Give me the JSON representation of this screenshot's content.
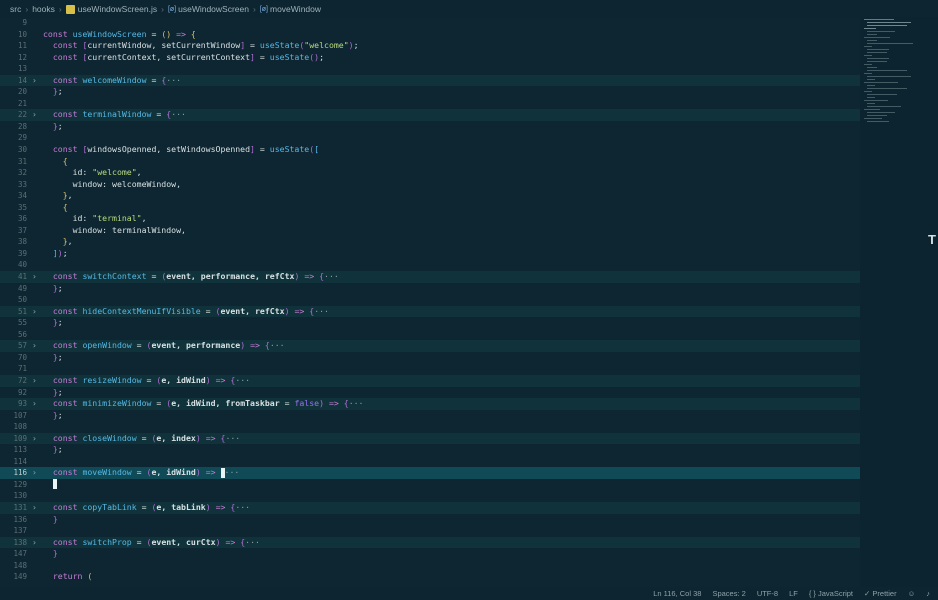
{
  "breadcrumb": {
    "items": [
      "src",
      "hooks",
      "useWindowScreen.js",
      "useWindowScreen",
      "moveWindow"
    ],
    "symbol_prefix": "[ø]"
  },
  "status": {
    "position": "Ln 116, Col 38",
    "spaces": "Spaces: 2",
    "encoding": "UTF-8",
    "eol": "LF",
    "language": "{ } JavaScript",
    "formatter": "✓ Prettier",
    "feedback_icon": "person-icon",
    "bell_icon": "bell-icon"
  },
  "colors": {
    "background": "#0d2631",
    "keyword": "#c77dd6",
    "variable": "#e7a35b",
    "function": "#56b8e6",
    "string": "#b9d981",
    "current_line": "#0f4a56"
  },
  "lines": [
    {
      "n": "9",
      "fold": false,
      "segs": []
    },
    {
      "n": "10",
      "fold": false,
      "segs": [
        [
          "k",
          "const "
        ],
        [
          "f",
          "useWindowScreen"
        ],
        [
          "w",
          " = "
        ],
        [
          "p",
          "()"
        ],
        [
          "w",
          " "
        ],
        [
          "k",
          "=>"
        ],
        [
          "w",
          " "
        ],
        [
          "p",
          "{"
        ]
      ]
    },
    {
      "n": "11",
      "fold": false,
      "segs": [
        [
          "w",
          "  "
        ],
        [
          "k",
          "const "
        ],
        [
          "pp",
          "["
        ],
        [
          "w",
          "currentWindow, setCurrentWindow"
        ],
        [
          "pp",
          "]"
        ],
        [
          "w",
          " = "
        ],
        [
          "f",
          "useState"
        ],
        [
          "pp",
          "("
        ],
        [
          "s",
          "\"welcome\""
        ],
        [
          "pp",
          ")"
        ],
        [
          "w",
          ";"
        ]
      ]
    },
    {
      "n": "12",
      "fold": false,
      "segs": [
        [
          "w",
          "  "
        ],
        [
          "k",
          "const "
        ],
        [
          "pp",
          "["
        ],
        [
          "w",
          "currentContext, setCurrentContext"
        ],
        [
          "pp",
          "]"
        ],
        [
          "w",
          " = "
        ],
        [
          "f",
          "useState"
        ],
        [
          "pp",
          "()"
        ],
        [
          "w",
          ";"
        ]
      ]
    },
    {
      "n": "13",
      "fold": false,
      "segs": []
    },
    {
      "n": "14",
      "fold": true,
      "segs": [
        [
          "w",
          "  "
        ],
        [
          "k",
          "const "
        ],
        [
          "f",
          "welcomeWindow"
        ],
        [
          "w",
          " = "
        ],
        [
          "pp",
          "{"
        ],
        [
          "fold-ell",
          "···"
        ]
      ]
    },
    {
      "n": "20",
      "fold": false,
      "segs": [
        [
          "w",
          "  "
        ],
        [
          "pp",
          "}"
        ],
        [
          "w",
          ";"
        ]
      ]
    },
    {
      "n": "21",
      "fold": false,
      "segs": []
    },
    {
      "n": "22",
      "fold": true,
      "segs": [
        [
          "w",
          "  "
        ],
        [
          "k",
          "const "
        ],
        [
          "f",
          "terminalWindow"
        ],
        [
          "w",
          " = "
        ],
        [
          "pp",
          "{"
        ],
        [
          "fold-ell",
          "···"
        ]
      ]
    },
    {
      "n": "28",
      "fold": false,
      "segs": [
        [
          "w",
          "  "
        ],
        [
          "pp",
          "}"
        ],
        [
          "w",
          ";"
        ]
      ]
    },
    {
      "n": "29",
      "fold": false,
      "segs": []
    },
    {
      "n": "30",
      "fold": false,
      "segs": [
        [
          "w",
          "  "
        ],
        [
          "k",
          "const "
        ],
        [
          "pp",
          "["
        ],
        [
          "w",
          "windowsOpenned, setWindowsOpenned"
        ],
        [
          "pp",
          "]"
        ],
        [
          "w",
          " = "
        ],
        [
          "f",
          "useState"
        ],
        [
          "pp",
          "("
        ],
        [
          "f",
          "["
        ]
      ]
    },
    {
      "n": "31",
      "fold": false,
      "segs": [
        [
          "w",
          "    "
        ],
        [
          "p",
          "{"
        ]
      ]
    },
    {
      "n": "32",
      "fold": false,
      "segs": [
        [
          "w",
          "      id: "
        ],
        [
          "s",
          "\"welcome\""
        ],
        [
          "w",
          ","
        ]
      ]
    },
    {
      "n": "33",
      "fold": false,
      "segs": [
        [
          "w",
          "      window: welcomeWindow,"
        ]
      ]
    },
    {
      "n": "34",
      "fold": false,
      "segs": [
        [
          "w",
          "    "
        ],
        [
          "p",
          "}"
        ],
        [
          "w",
          ","
        ]
      ]
    },
    {
      "n": "35",
      "fold": false,
      "segs": [
        [
          "w",
          "    "
        ],
        [
          "p",
          "{"
        ]
      ]
    },
    {
      "n": "36",
      "fold": false,
      "segs": [
        [
          "w",
          "      id: "
        ],
        [
          "s",
          "\"terminal\""
        ],
        [
          "w",
          ","
        ]
      ]
    },
    {
      "n": "37",
      "fold": false,
      "segs": [
        [
          "w",
          "      window: terminalWindow,"
        ]
      ]
    },
    {
      "n": "38",
      "fold": false,
      "segs": [
        [
          "w",
          "    "
        ],
        [
          "p",
          "}"
        ],
        [
          "w",
          ","
        ]
      ]
    },
    {
      "n": "39",
      "fold": false,
      "segs": [
        [
          "w",
          "  "
        ],
        [
          "f",
          "]"
        ],
        [
          "pp",
          ")"
        ],
        [
          "w",
          ";"
        ]
      ]
    },
    {
      "n": "40",
      "fold": false,
      "segs": []
    },
    {
      "n": "41",
      "fold": true,
      "segs": [
        [
          "w",
          "  "
        ],
        [
          "k",
          "const "
        ],
        [
          "f",
          "switchContext"
        ],
        [
          "w",
          " = "
        ],
        [
          "pp",
          "("
        ],
        [
          "b",
          "event, performance, refCtx"
        ],
        [
          "pp",
          ")"
        ],
        [
          "w",
          " "
        ],
        [
          "k",
          "=>"
        ],
        [
          "w",
          " "
        ],
        [
          "pp",
          "{"
        ],
        [
          "fold-ell",
          "···"
        ]
      ]
    },
    {
      "n": "49",
      "fold": false,
      "segs": [
        [
          "w",
          "  "
        ],
        [
          "pp",
          "}"
        ],
        [
          "w",
          ";"
        ]
      ]
    },
    {
      "n": "50",
      "fold": false,
      "segs": []
    },
    {
      "n": "51",
      "fold": true,
      "segs": [
        [
          "w",
          "  "
        ],
        [
          "k",
          "const "
        ],
        [
          "f",
          "hideContextMenuIfVisible"
        ],
        [
          "w",
          " = "
        ],
        [
          "pp",
          "("
        ],
        [
          "b",
          "event, refCtx"
        ],
        [
          "pp",
          ")"
        ],
        [
          "w",
          " "
        ],
        [
          "k",
          "=>"
        ],
        [
          "w",
          " "
        ],
        [
          "pp",
          "{"
        ],
        [
          "fold-ell",
          "···"
        ]
      ]
    },
    {
      "n": "55",
      "fold": false,
      "segs": [
        [
          "w",
          "  "
        ],
        [
          "pp",
          "}"
        ],
        [
          "w",
          ";"
        ]
      ]
    },
    {
      "n": "56",
      "fold": false,
      "segs": []
    },
    {
      "n": "57",
      "fold": true,
      "segs": [
        [
          "w",
          "  "
        ],
        [
          "k",
          "const "
        ],
        [
          "f",
          "openWindow"
        ],
        [
          "w",
          " = "
        ],
        [
          "pp",
          "("
        ],
        [
          "b",
          "event, performance"
        ],
        [
          "pp",
          ")"
        ],
        [
          "w",
          " "
        ],
        [
          "k",
          "=>"
        ],
        [
          "w",
          " "
        ],
        [
          "pp",
          "{"
        ],
        [
          "fold-ell",
          "···"
        ]
      ]
    },
    {
      "n": "70",
      "fold": false,
      "segs": [
        [
          "w",
          "  "
        ],
        [
          "pp",
          "}"
        ],
        [
          "w",
          ";"
        ]
      ]
    },
    {
      "n": "71",
      "fold": false,
      "segs": []
    },
    {
      "n": "72",
      "fold": true,
      "segs": [
        [
          "w",
          "  "
        ],
        [
          "k",
          "const "
        ],
        [
          "f",
          "resizeWindow"
        ],
        [
          "w",
          " = "
        ],
        [
          "pp",
          "("
        ],
        [
          "b",
          "e, idWind"
        ],
        [
          "pp",
          ")"
        ],
        [
          "w",
          " "
        ],
        [
          "k",
          "=>"
        ],
        [
          "w",
          " "
        ],
        [
          "pp",
          "{"
        ],
        [
          "fold-ell",
          "···"
        ]
      ]
    },
    {
      "n": "92",
      "fold": false,
      "segs": [
        [
          "w",
          "  "
        ],
        [
          "pp",
          "}"
        ],
        [
          "w",
          ";"
        ]
      ]
    },
    {
      "n": "93",
      "fold": true,
      "segs": [
        [
          "w",
          "  "
        ],
        [
          "k",
          "const "
        ],
        [
          "f",
          "minimizeWindow"
        ],
        [
          "w",
          " = "
        ],
        [
          "pp",
          "("
        ],
        [
          "b",
          "e, idWind, fromTaskbar"
        ],
        [
          "w",
          " = "
        ],
        [
          "bool",
          "false"
        ],
        [
          "pp",
          ")"
        ],
        [
          "w",
          " "
        ],
        [
          "k",
          "=>"
        ],
        [
          "w",
          " "
        ],
        [
          "pp",
          "{"
        ],
        [
          "fold-ell",
          "···"
        ]
      ]
    },
    {
      "n": "107",
      "fold": false,
      "segs": [
        [
          "w",
          "  "
        ],
        [
          "pp",
          "}"
        ],
        [
          "w",
          ";"
        ]
      ]
    },
    {
      "n": "108",
      "fold": false,
      "segs": []
    },
    {
      "n": "109",
      "fold": true,
      "segs": [
        [
          "w",
          "  "
        ],
        [
          "k",
          "const "
        ],
        [
          "f",
          "closeWindow"
        ],
        [
          "w",
          " = "
        ],
        [
          "pp",
          "("
        ],
        [
          "b",
          "e, index"
        ],
        [
          "pp",
          ")"
        ],
        [
          "w",
          " "
        ],
        [
          "k",
          "=>"
        ],
        [
          "w",
          " "
        ],
        [
          "pp",
          "{"
        ],
        [
          "fold-ell",
          "···"
        ]
      ]
    },
    {
      "n": "113",
      "fold": false,
      "segs": [
        [
          "w",
          "  "
        ],
        [
          "pp",
          "}"
        ],
        [
          "w",
          ";"
        ]
      ]
    },
    {
      "n": "114",
      "fold": false,
      "segs": []
    },
    {
      "n": "116",
      "fold": true,
      "current": true,
      "segs": [
        [
          "w",
          "  "
        ],
        [
          "k",
          "const "
        ],
        [
          "f",
          "moveWindow"
        ],
        [
          "w",
          " = "
        ],
        [
          "pp",
          "("
        ],
        [
          "b",
          "e, idWind"
        ],
        [
          "pp",
          ")"
        ],
        [
          "w",
          " "
        ],
        [
          "k",
          "=>"
        ],
        [
          "w",
          " "
        ],
        [
          "cursor",
          ""
        ],
        [
          "fold-ell",
          "···"
        ]
      ]
    },
    {
      "n": "129",
      "fold": false,
      "segs": [
        [
          "w",
          "  "
        ],
        [
          "cursor",
          ""
        ]
      ]
    },
    {
      "n": "130",
      "fold": false,
      "segs": []
    },
    {
      "n": "131",
      "fold": true,
      "segs": [
        [
          "w",
          "  "
        ],
        [
          "k",
          "const "
        ],
        [
          "f",
          "copyTabLink"
        ],
        [
          "w",
          " = "
        ],
        [
          "pp",
          "("
        ],
        [
          "b",
          "e, tabLink"
        ],
        [
          "pp",
          ")"
        ],
        [
          "w",
          " "
        ],
        [
          "k",
          "=>"
        ],
        [
          "w",
          " "
        ],
        [
          "pp",
          "{"
        ],
        [
          "fold-ell",
          "···"
        ]
      ]
    },
    {
      "n": "136",
      "fold": false,
      "segs": [
        [
          "w",
          "  "
        ],
        [
          "pp",
          "}"
        ]
      ]
    },
    {
      "n": "137",
      "fold": false,
      "segs": []
    },
    {
      "n": "138",
      "fold": true,
      "segs": [
        [
          "w",
          "  "
        ],
        [
          "k",
          "const "
        ],
        [
          "f",
          "switchProp"
        ],
        [
          "w",
          " = "
        ],
        [
          "pp",
          "("
        ],
        [
          "b",
          "event, curCtx"
        ],
        [
          "pp",
          ")"
        ],
        [
          "w",
          " "
        ],
        [
          "k",
          "=>"
        ],
        [
          "w",
          " "
        ],
        [
          "pp",
          "{"
        ],
        [
          "fold-ell",
          "···"
        ]
      ]
    },
    {
      "n": "147",
      "fold": false,
      "segs": [
        [
          "w",
          "  "
        ],
        [
          "pp",
          "}"
        ]
      ]
    },
    {
      "n": "148",
      "fold": false,
      "segs": []
    },
    {
      "n": "149",
      "fold": false,
      "segs": [
        [
          "w",
          "  "
        ],
        [
          "k",
          "return "
        ],
        [
          "p",
          "("
        ]
      ]
    }
  ]
}
